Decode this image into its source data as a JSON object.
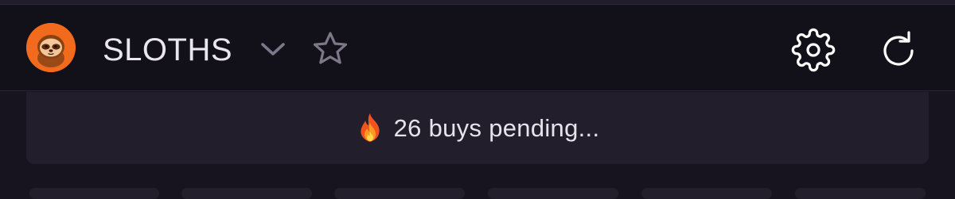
{
  "header": {
    "token_name": "SLOTHS",
    "avatar_icon": "sloth-avatar-icon",
    "chevron_icon": "chevron-down-icon",
    "star_icon": "star-icon",
    "settings_icon": "gear-icon",
    "refresh_icon": "refresh-icon"
  },
  "banner": {
    "icon": "fire-icon",
    "text": "26 buys pending..."
  },
  "colors": {
    "background": "#18141f",
    "header_background": "#121018",
    "banner_background": "#221e2b",
    "avatar_orange": "#f26b1d",
    "text": "#e9e6ef",
    "icon_muted": "#7d7889"
  }
}
